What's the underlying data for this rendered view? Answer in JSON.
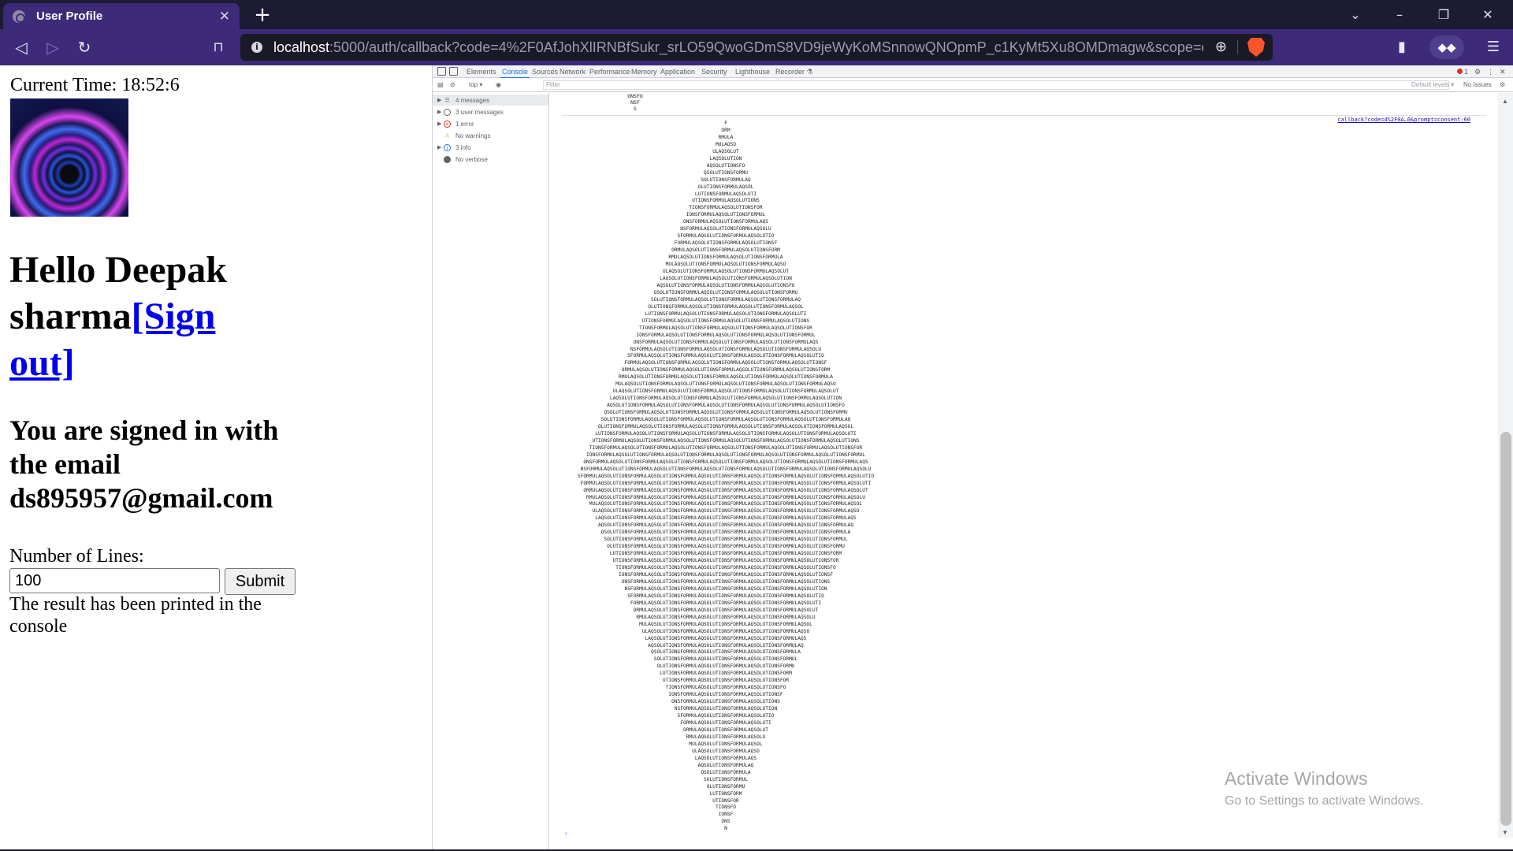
{
  "browser": {
    "tab_title": "User Profile",
    "tab_close": "✕",
    "new_tab": "+",
    "url_host": "localhost",
    "url_rest": ":5000/auth/callback?code=4%2F0AfJohXlIRNBfSukr_srLO59QwoGDmS8VD9jeWyKoMSnnowQNOpmP_c1KyMt5Xu8OMDmagw&scope=email...",
    "window_controls": {
      "chevron": "⌄",
      "minimize": "–",
      "restore": "❐",
      "close": "✕"
    }
  },
  "page": {
    "current_time": "Current Time: 18:52:6",
    "hello_prefix": "Hello Deepak sharma",
    "sign_out": "[Sign out]",
    "signed_in": "You are signed in with the email ds895957@gmail.com",
    "lines_label": "Number of Lines:",
    "lines_value": "100",
    "submit_label": "Submit",
    "result_text": "The result has been printed in the console"
  },
  "devtools": {
    "tabs": [
      "Elements",
      "Console",
      "Sources",
      "Network",
      "Performance",
      "Memory",
      "Application",
      "Security",
      "Lighthouse",
      "Recorder ⚗"
    ],
    "active_tab": "Console",
    "error_count": "1",
    "context": "top ▾",
    "filter_placeholder": "Filter",
    "levels": "Default levels ▾",
    "issues": "No Issues",
    "sidebar": [
      {
        "label": "4 messages",
        "icon": "list-icon",
        "color": "#5f6368",
        "expandable": true
      },
      {
        "label": "3 user messages",
        "icon": "user-icon",
        "color": "#5f6368",
        "expandable": true
      },
      {
        "label": "1 error",
        "icon": "error-icon",
        "color": "#d93025",
        "expandable": true
      },
      {
        "label": "No warnings",
        "icon": "warning-icon",
        "color": "#f29900",
        "expandable": false
      },
      {
        "label": "3 info",
        "icon": "info-icon",
        "color": "#1a73e8",
        "expandable": true
      },
      {
        "label": "No verbose",
        "icon": "bug-icon",
        "color": "#5f6368",
        "expandable": false
      }
    ],
    "previous_output": [
      "ONSFO",
      "NSF",
      "S"
    ],
    "source_link": "callback?code=4%2F0A…0&prompt=consent:60",
    "pattern": "FORMULAQSOLUTIONS",
    "pattern_rows": 101
  },
  "watermark": {
    "title": "Activate Windows",
    "subtitle": "Go to Settings to activate Windows."
  }
}
